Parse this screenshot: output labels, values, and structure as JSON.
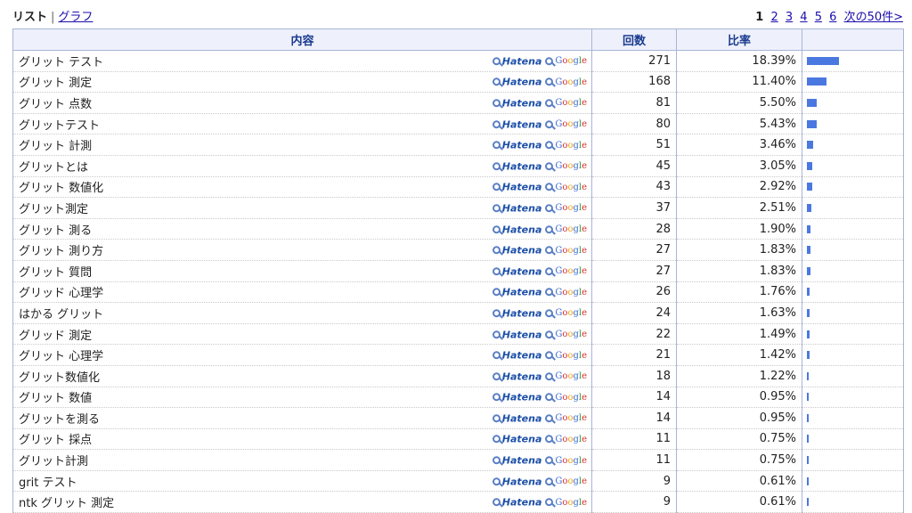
{
  "views": {
    "current": "リスト",
    "separator": "|",
    "other": "グラフ"
  },
  "pager": {
    "current": "1",
    "pages": [
      "2",
      "3",
      "4",
      "5",
      "6"
    ],
    "next": "次の50件>"
  },
  "headers": {
    "content": "内容",
    "count": "回数",
    "ratio": "比率",
    "bar": ""
  },
  "links": {
    "hatena": "Hatena",
    "google_letters": [
      "G",
      "o",
      "o",
      "g",
      "l",
      "e"
    ]
  },
  "bar_color": "#4a78e0",
  "rows": [
    {
      "keyword": "グリット テスト",
      "count": "271",
      "pct": "18.39%",
      "ratio": 0.1839
    },
    {
      "keyword": "グリット 測定",
      "count": "168",
      "pct": "11.40%",
      "ratio": 0.114
    },
    {
      "keyword": "グリット 点数",
      "count": "81",
      "pct": "5.50%",
      "ratio": 0.055
    },
    {
      "keyword": "グリットテスト",
      "count": "80",
      "pct": "5.43%",
      "ratio": 0.0543
    },
    {
      "keyword": "グリット 計測",
      "count": "51",
      "pct": "3.46%",
      "ratio": 0.0346
    },
    {
      "keyword": "グリットとは",
      "count": "45",
      "pct": "3.05%",
      "ratio": 0.0305
    },
    {
      "keyword": "グリット 数値化",
      "count": "43",
      "pct": "2.92%",
      "ratio": 0.0292
    },
    {
      "keyword": "グリット測定",
      "count": "37",
      "pct": "2.51%",
      "ratio": 0.0251
    },
    {
      "keyword": "グリット 測る",
      "count": "28",
      "pct": "1.90%",
      "ratio": 0.019
    },
    {
      "keyword": "グリット 測り方",
      "count": "27",
      "pct": "1.83%",
      "ratio": 0.0183
    },
    {
      "keyword": "グリット 質問",
      "count": "27",
      "pct": "1.83%",
      "ratio": 0.0183
    },
    {
      "keyword": "グリッド 心理学",
      "count": "26",
      "pct": "1.76%",
      "ratio": 0.0176
    },
    {
      "keyword": "はかる グリット",
      "count": "24",
      "pct": "1.63%",
      "ratio": 0.0163
    },
    {
      "keyword": "グリッド 測定",
      "count": "22",
      "pct": "1.49%",
      "ratio": 0.0149
    },
    {
      "keyword": "グリット 心理学",
      "count": "21",
      "pct": "1.42%",
      "ratio": 0.0142
    },
    {
      "keyword": "グリット数値化",
      "count": "18",
      "pct": "1.22%",
      "ratio": 0.0122
    },
    {
      "keyword": "グリット 数値",
      "count": "14",
      "pct": "0.95%",
      "ratio": 0.0095
    },
    {
      "keyword": "グリットを測る",
      "count": "14",
      "pct": "0.95%",
      "ratio": 0.0095
    },
    {
      "keyword": "グリット 採点",
      "count": "11",
      "pct": "0.75%",
      "ratio": 0.0075
    },
    {
      "keyword": "グリット計測",
      "count": "11",
      "pct": "0.75%",
      "ratio": 0.0075
    },
    {
      "keyword": "grit テスト",
      "count": "9",
      "pct": "0.61%",
      "ratio": 0.0061
    },
    {
      "keyword": "ntk グリット 測定",
      "count": "9",
      "pct": "0.61%",
      "ratio": 0.0061
    }
  ]
}
